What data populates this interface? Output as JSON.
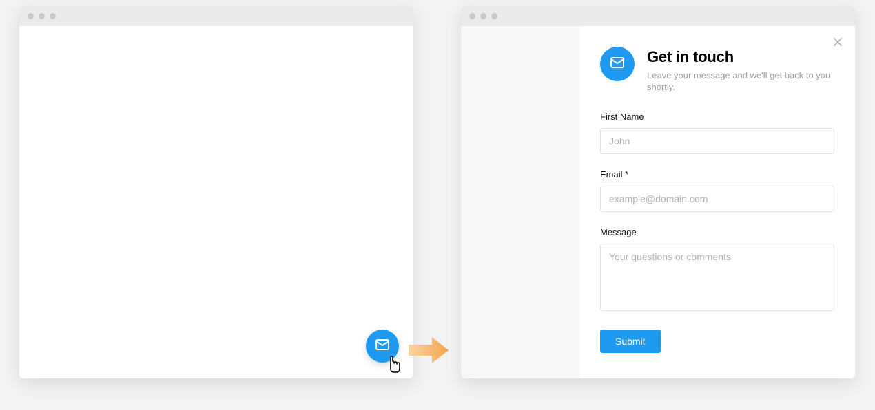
{
  "panel": {
    "title": "Get in touch",
    "subtitle": "Leave your message and we'll get back to you shortly."
  },
  "fields": {
    "first_name": {
      "label": "First Name",
      "placeholder": "John"
    },
    "email": {
      "label": "Email *",
      "placeholder": "example@domain.com"
    },
    "message": {
      "label": "Message",
      "placeholder": "Your questions or comments"
    }
  },
  "actions": {
    "submit_label": "Submit"
  },
  "colors": {
    "accent": "#1e9bf0"
  }
}
